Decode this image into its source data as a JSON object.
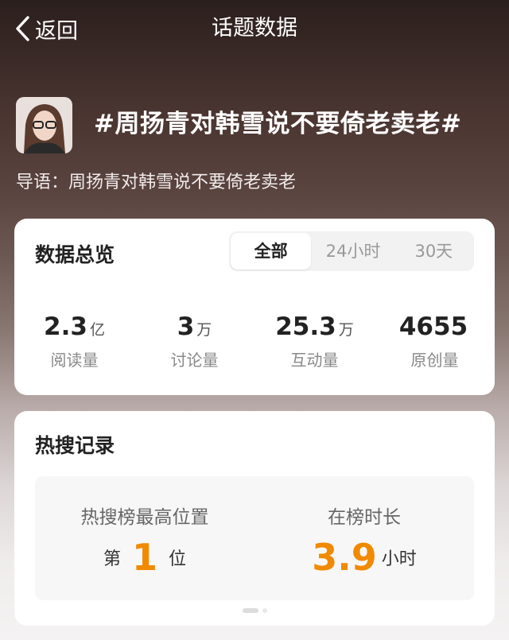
{
  "header": {
    "back_label": "返回",
    "title": "话题数据"
  },
  "topic": {
    "name": "#周扬青对韩雪说不要倚老卖老#",
    "intro": "导语：周扬青对韩雪说不要倚老卖老"
  },
  "overview": {
    "title": "数据总览",
    "tabs": [
      "全部",
      "24小时",
      "30天"
    ],
    "active_tab": "全部",
    "stats": [
      {
        "value": "2.3",
        "unit": "亿",
        "label": "阅读量"
      },
      {
        "value": "3",
        "unit": "万",
        "label": "讨论量"
      },
      {
        "value": "25.3",
        "unit": "万",
        "label": "互动量"
      },
      {
        "value": "4655",
        "unit": "",
        "label": "原创量"
      }
    ]
  },
  "hot": {
    "title": "热搜记录",
    "best_rank": {
      "label": "热搜榜最高位置",
      "prefix": "第",
      "value": "1",
      "suffix": "位"
    },
    "duration": {
      "label": "在榜时长",
      "value": "3.9",
      "suffix": "小时"
    }
  },
  "colors": {
    "accent": "#f08a00"
  },
  "icons": {
    "back": "chevron-left-icon"
  }
}
